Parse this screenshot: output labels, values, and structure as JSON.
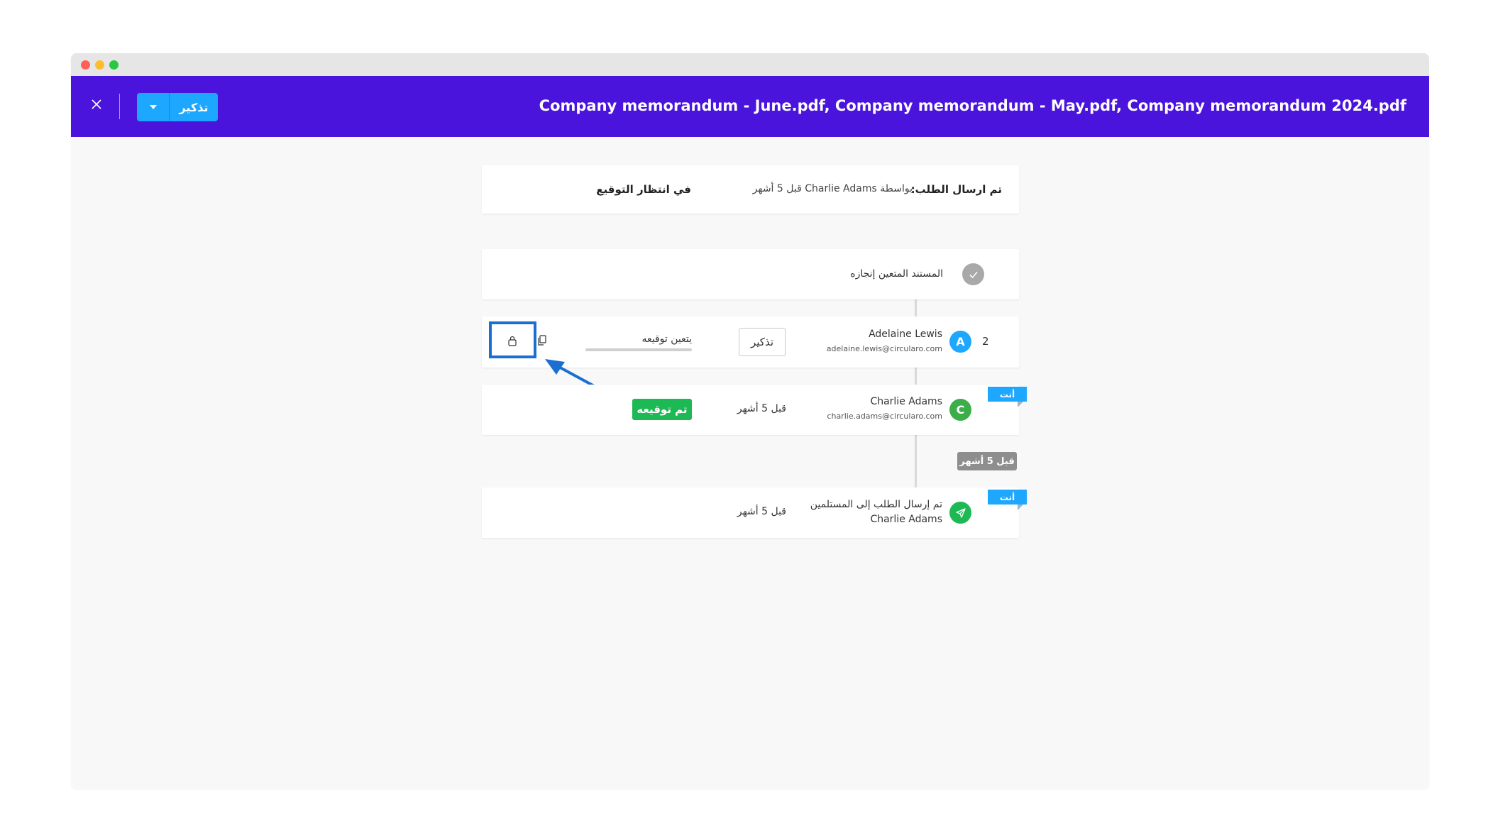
{
  "window": {
    "document_title": "Company memorandum - June.pdf, Company memorandum - May.pdf, Company memorandum 2024.pdf",
    "remind_button_label": "تذكير"
  },
  "summary": {
    "sent_label": "تم ارسال الطلب:",
    "sent_detail": "بواسطة Charlie Adams قبل 5 أشهر",
    "status": "في انتظار التوقيع"
  },
  "timeline": {
    "pending_step": {
      "label": "المستند المتعين إنجازه"
    },
    "signer_pending": {
      "order": "2",
      "avatar_letter": "A",
      "name": "Adelaine Lewis",
      "email": "adelaine.lewis@circularo.com",
      "remind_label": "تذكير",
      "status_label": "يتعين توقيعه",
      "progress": 0
    },
    "signer_done": {
      "avatar_letter": "C",
      "name": "Charlie Adams",
      "email": "charlie.adams@circularo.com",
      "time": "قبل 5 أشهر",
      "badge": "تم توقيعه",
      "you_flag": "أنت"
    },
    "time_divider": "قبل 5 أشهر",
    "sent_event": {
      "label": "تم إرسال الطلب إلى المستلمين",
      "sender": "Charlie Adams",
      "time": "قبل 5 أشهر",
      "you_flag": "أنت"
    }
  },
  "colors": {
    "header_bg": "#4a14dc",
    "accent_blue": "#1ea7ff",
    "signed_green": "#1db954",
    "highlight_blue": "#1b6fd1"
  },
  "icons": [
    "close-icon",
    "caret-down-icon",
    "check-icon",
    "lock-icon",
    "copy-icon",
    "send-icon"
  ]
}
